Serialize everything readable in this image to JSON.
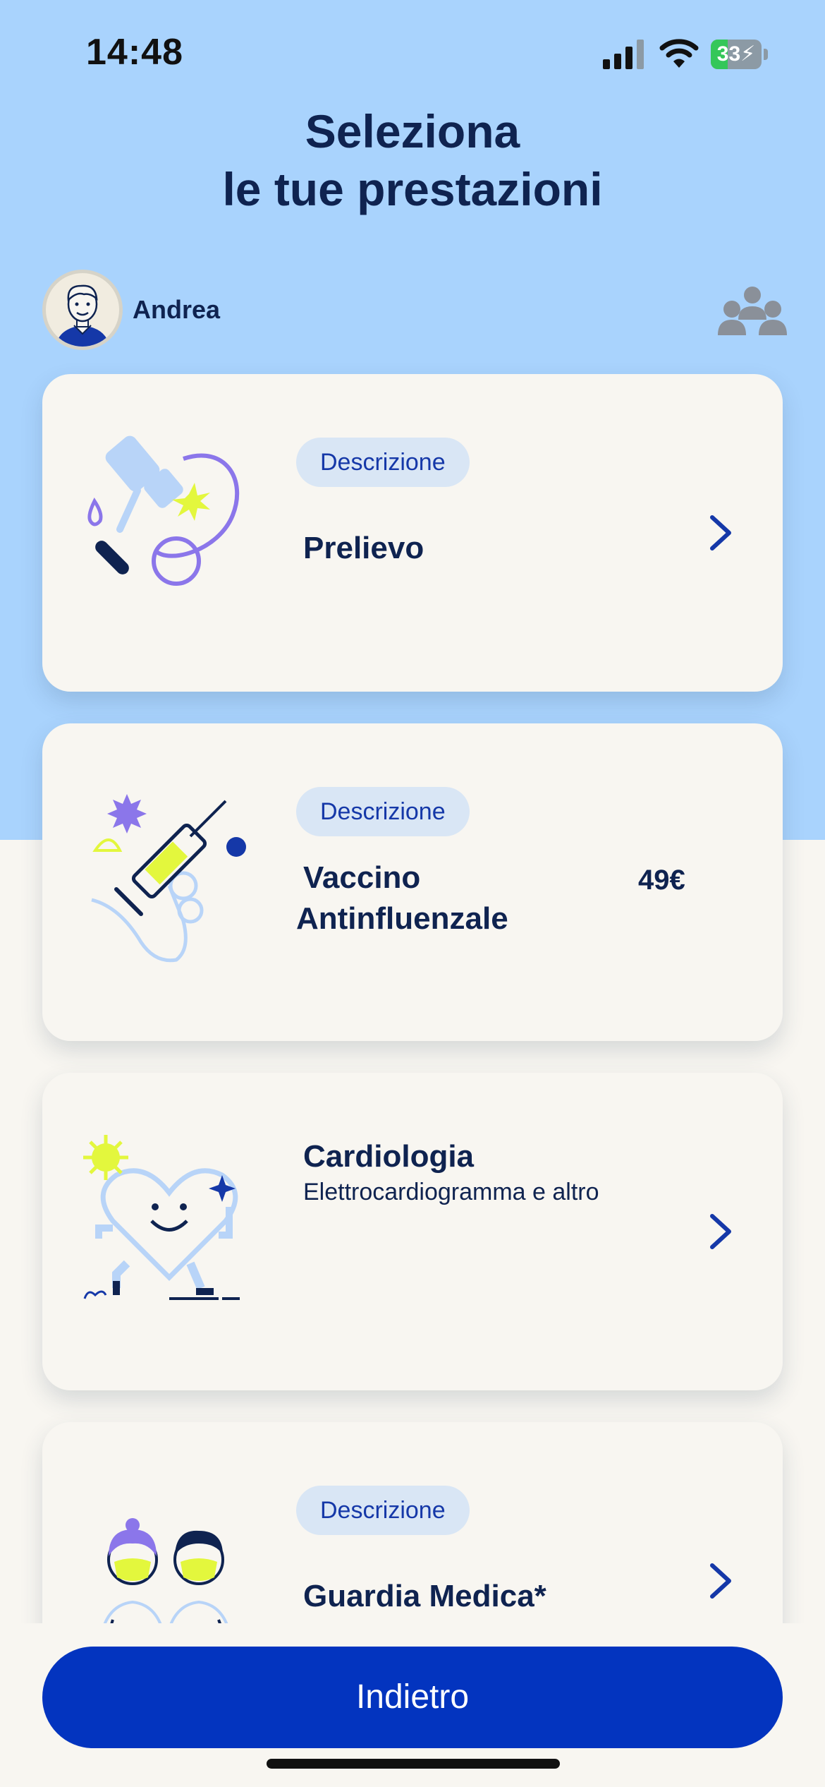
{
  "status_bar": {
    "time": "14:48",
    "battery": "33",
    "battery_level": 0.33
  },
  "header": {
    "title_line1": "Seleziona",
    "title_line2": "le tue prestazioni"
  },
  "user": {
    "name": "Andrea"
  },
  "cards": [
    {
      "chip": "Descrizione",
      "name": "Prelievo",
      "icon": "blood-draw-illustration"
    },
    {
      "chip": "Descrizione",
      "name_line1": "Vaccino",
      "name_line2": "Antinfluenzale",
      "price": "49€",
      "icon": "vaccine-syringe-illustration"
    },
    {
      "name": "Cardiologia",
      "subtitle": "Elettrocardiogramma e altro",
      "icon": "heart-illustration"
    },
    {
      "chip": "Descrizione",
      "name": "Guardia Medica*",
      "icon": "doctors-illustration"
    }
  ],
  "footer": {
    "back_label": "Indietro"
  },
  "colors": {
    "header_bg": "#a9d3fd",
    "page_bg": "#f8f6f1",
    "primary": "#0334bf",
    "text": "#0f2350",
    "chip_bg": "#d9e6f5"
  }
}
